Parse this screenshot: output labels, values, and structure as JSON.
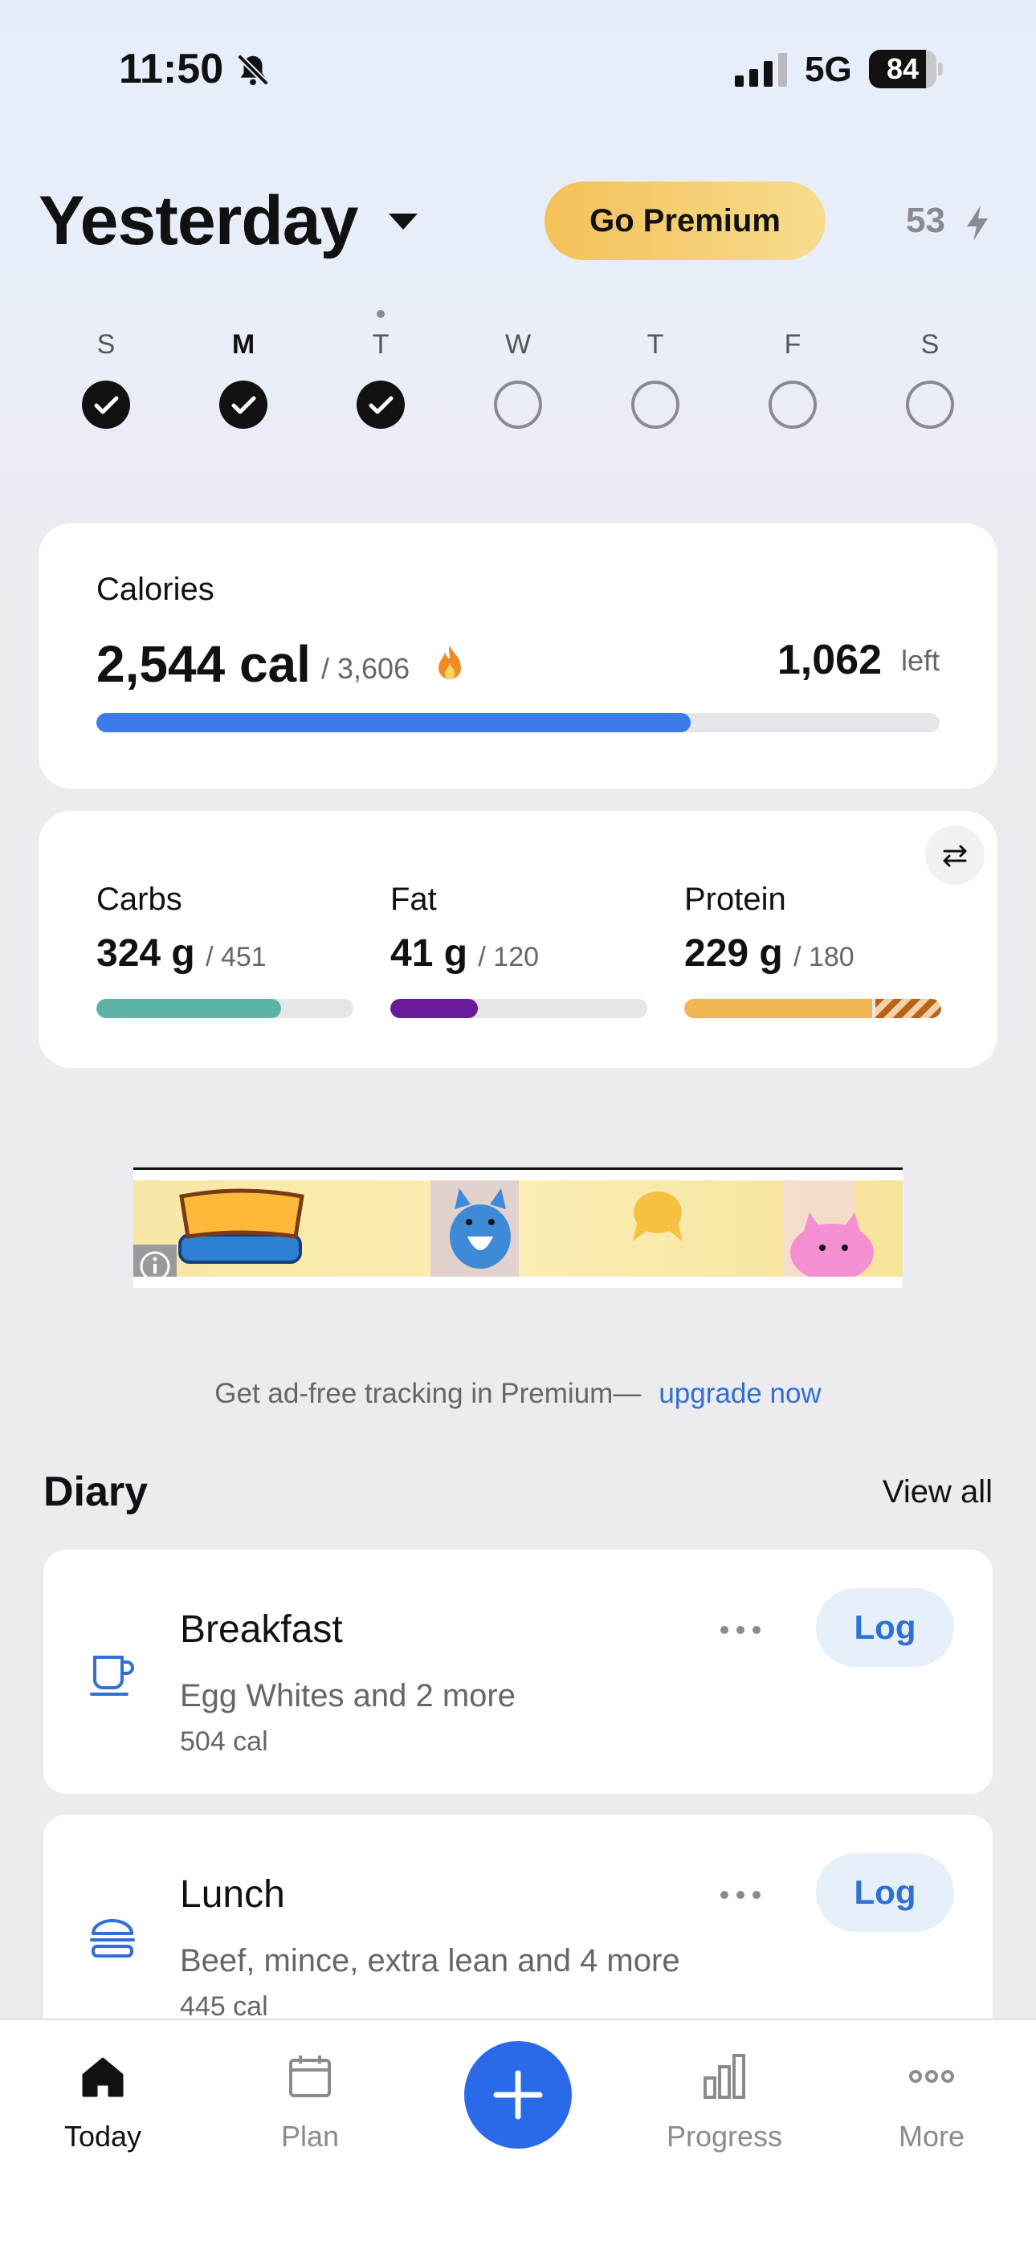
{
  "status_bar": {
    "time": "11:50",
    "network": "5G",
    "battery": "84",
    "battery_level": 0.84
  },
  "header": {
    "title": "Yesterday",
    "premium_label": "Go Premium",
    "streak_count": "53"
  },
  "week": [
    {
      "label": "S",
      "completed": true,
      "today": false,
      "bold": false
    },
    {
      "label": "M",
      "completed": true,
      "today": false,
      "bold": true
    },
    {
      "label": "T",
      "completed": true,
      "today": true,
      "bold": false
    },
    {
      "label": "W",
      "completed": false,
      "today": false,
      "bold": false
    },
    {
      "label": "T",
      "completed": false,
      "today": false,
      "bold": false
    },
    {
      "label": "F",
      "completed": false,
      "today": false,
      "bold": false
    },
    {
      "label": "S",
      "completed": false,
      "today": false,
      "bold": false
    }
  ],
  "calories": {
    "label": "Calories",
    "consumed": "2,544 cal",
    "goal": "/ 3,606",
    "left_value": "1,062",
    "left_label": "left",
    "progress": 0.705,
    "bar_color": "#3a7be8"
  },
  "macros": [
    {
      "name": "Carbs",
      "value": "324 g",
      "goal": "/ 451",
      "progress": 0.718,
      "over": 0,
      "color": "#5bb3a6"
    },
    {
      "name": "Fat",
      "value": "41 g",
      "goal": "/ 120",
      "progress": 0.342,
      "over": 0,
      "color": "#6a1b9a"
    },
    {
      "name": "Protein",
      "value": "229 g",
      "goal": "/ 180",
      "progress": 0.73,
      "over": 0.27,
      "color": "#f0b651"
    }
  ],
  "upsell": {
    "text": "Get ad-free tracking in Premium—",
    "link": "upgrade now"
  },
  "diary": {
    "title": "Diary",
    "view_all": "View all",
    "meals": [
      {
        "name": "Breakfast",
        "items": "Egg Whites and 2 more",
        "calories": "504 cal",
        "action": "Log",
        "icon": "cup-icon"
      },
      {
        "name": "Lunch",
        "items": "Beef, mince, extra lean and 4 more",
        "calories": "445 cal",
        "action": "Log",
        "icon": "burger-icon"
      }
    ]
  },
  "tabs": [
    {
      "label": "Today",
      "icon": "home-icon",
      "active": true
    },
    {
      "label": "Plan",
      "icon": "calendar-icon",
      "active": false
    },
    {
      "label": "Progress",
      "icon": "bar-chart-icon",
      "active": false
    },
    {
      "label": "More",
      "icon": "more-icon",
      "active": false
    }
  ],
  "colors": {
    "accent": "#2a6ae8",
    "link": "#2f6fd6",
    "premium": "#f3c158"
  }
}
